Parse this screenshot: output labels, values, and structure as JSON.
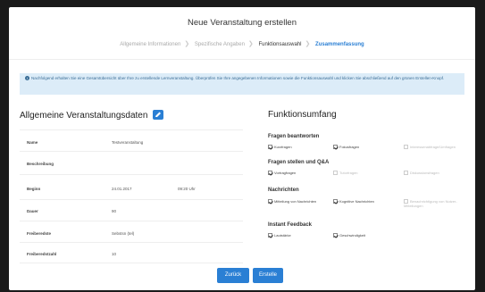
{
  "dialog": {
    "title": "Neue Veranstaltung erstellen"
  },
  "steps": [
    {
      "label": "Allgemeine Informationen",
      "state": "done"
    },
    {
      "label": "Spezifische Angaben",
      "state": "done"
    },
    {
      "label": "Funktionsauswahl",
      "state": "current"
    },
    {
      "label": "Zusammenfassung",
      "state": "active"
    }
  ],
  "info": {
    "text": "Nachfolgend erhalten Sie eine Gesamtübersicht über Ihre zu erstellende Lernveranstaltung. Überprüfen Sie Ihre angegebenen Informationen sowie die Funktionsauswahl und klicken Sie abschließend auf den grünen Erstellen-Knopf."
  },
  "left": {
    "heading": "Allgemeine Veranstaltungsdaten",
    "fields": [
      {
        "label": "Name",
        "value": "Testveranstaltung",
        "value2": ""
      },
      {
        "label": "Beschreibung",
        "value": "",
        "value2": ""
      },
      {
        "label": "Beginn",
        "value": "24.01.2017",
        "value2": "09:20 Uhr"
      },
      {
        "label": "Dauer",
        "value": "90",
        "value2": ""
      },
      {
        "label": "Freiberedste",
        "value": "Sebstsn (tel)",
        "value2": ""
      },
      {
        "label": "Freiberedstzahl",
        "value": "10",
        "value2": ""
      }
    ]
  },
  "right": {
    "heading": "Funktionsumfang",
    "sections": [
      {
        "title": "Fragen beantworten",
        "options": [
          {
            "label": "Kurzfragen",
            "checked": true,
            "disabled": false
          },
          {
            "label": "Fokusfragen",
            "checked": true,
            "disabled": false
          },
          {
            "label": "Interessenabfrage/Umfragen",
            "checked": false,
            "disabled": true
          }
        ]
      },
      {
        "title": "Fragen stellen und Q&A",
        "options": [
          {
            "label": "Vortragfragen",
            "checked": true,
            "disabled": false
          },
          {
            "label": "Tutorfragen",
            "checked": false,
            "disabled": true
          },
          {
            "label": "Diskussionsfragen",
            "checked": false,
            "disabled": true
          }
        ]
      },
      {
        "title": "Nachrichten",
        "options": [
          {
            "label": "Mitteilung von Nachrichten",
            "checked": true,
            "disabled": false
          },
          {
            "label": "Kognitive Nachrichten",
            "checked": true,
            "disabled": false
          },
          {
            "label": "Benachrichtigung von Nutzer-Mitteilungen",
            "checked": false,
            "disabled": true
          }
        ]
      },
      {
        "title": "Instant Feedback",
        "options": [
          {
            "label": "Lautstärke",
            "checked": true,
            "disabled": false
          },
          {
            "label": "Geschwindigkeit",
            "checked": true,
            "disabled": false
          }
        ]
      }
    ]
  },
  "buttons": {
    "back": "Zurück",
    "create": "Erstelle"
  },
  "colors": {
    "accent": "#2a7fd4",
    "info_bg": "#dcecf8",
    "info_text": "#3a6d96"
  }
}
